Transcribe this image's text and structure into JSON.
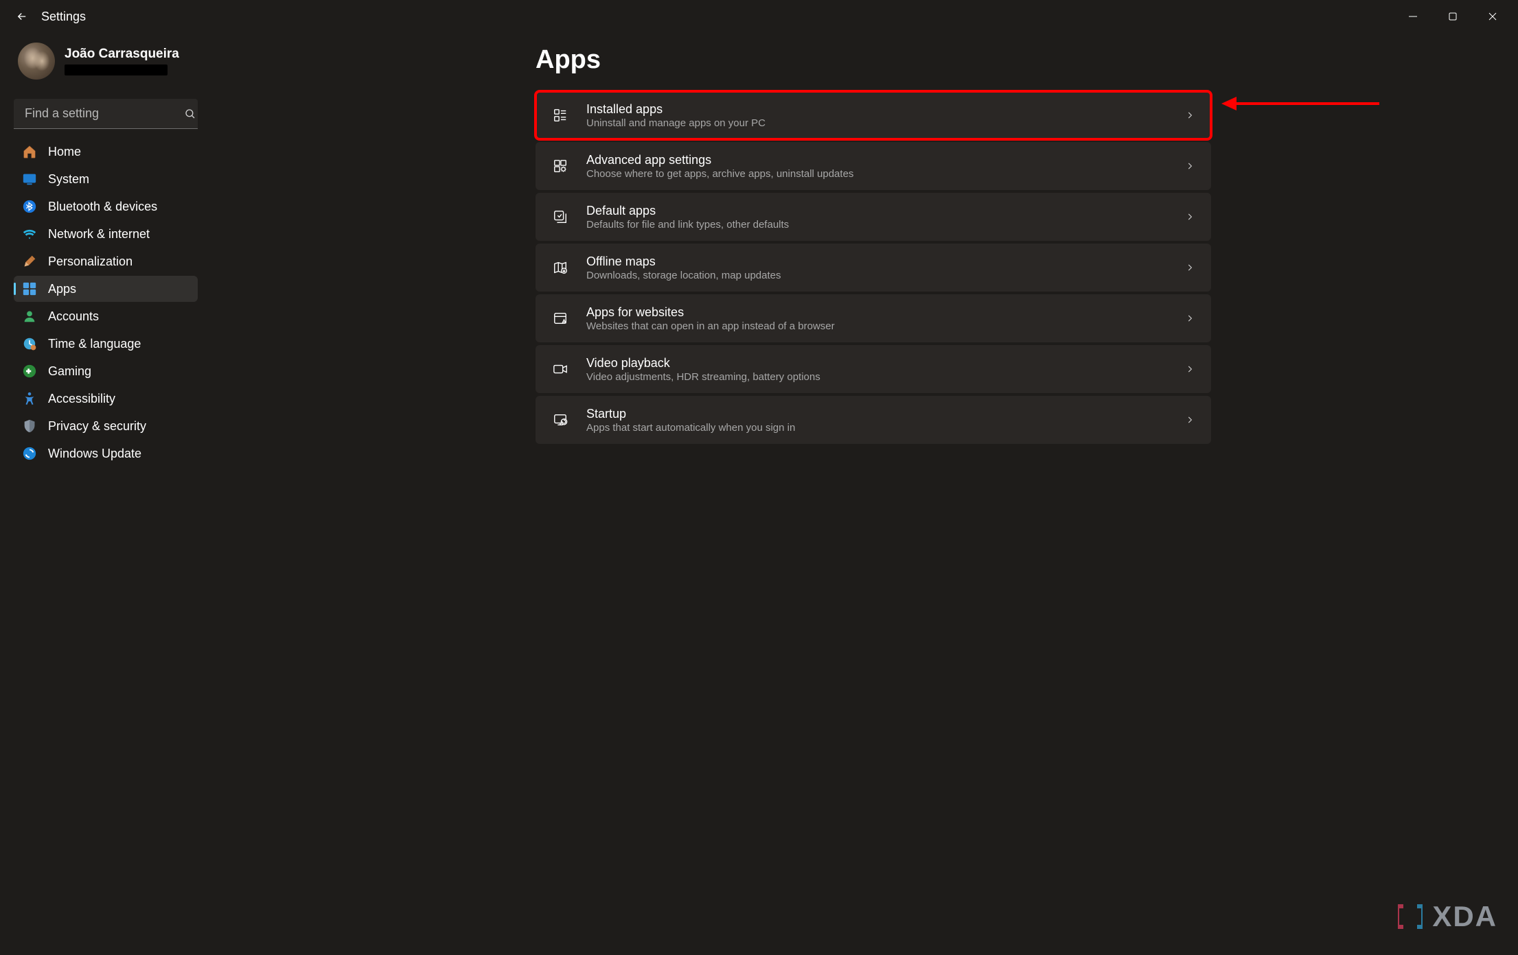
{
  "window": {
    "title": "Settings"
  },
  "user": {
    "name": "João Carrasqueira"
  },
  "search": {
    "placeholder": "Find a setting"
  },
  "nav": {
    "items": [
      {
        "label": "Home"
      },
      {
        "label": "System"
      },
      {
        "label": "Bluetooth & devices"
      },
      {
        "label": "Network & internet"
      },
      {
        "label": "Personalization"
      },
      {
        "label": "Apps"
      },
      {
        "label": "Accounts"
      },
      {
        "label": "Time & language"
      },
      {
        "label": "Gaming"
      },
      {
        "label": "Accessibility"
      },
      {
        "label": "Privacy & security"
      },
      {
        "label": "Windows Update"
      }
    ]
  },
  "page": {
    "title": "Apps",
    "cards": [
      {
        "title": "Installed apps",
        "sub": "Uninstall and manage apps on your PC"
      },
      {
        "title": "Advanced app settings",
        "sub": "Choose where to get apps, archive apps, uninstall updates"
      },
      {
        "title": "Default apps",
        "sub": "Defaults for file and link types, other defaults"
      },
      {
        "title": "Offline maps",
        "sub": "Downloads, storage location, map updates"
      },
      {
        "title": "Apps for websites",
        "sub": "Websites that can open in an app instead of a browser"
      },
      {
        "title": "Video playback",
        "sub": "Video adjustments, HDR streaming, battery options"
      },
      {
        "title": "Startup",
        "sub": "Apps that start automatically when you sign in"
      }
    ]
  },
  "watermark": {
    "text": "XDA"
  }
}
